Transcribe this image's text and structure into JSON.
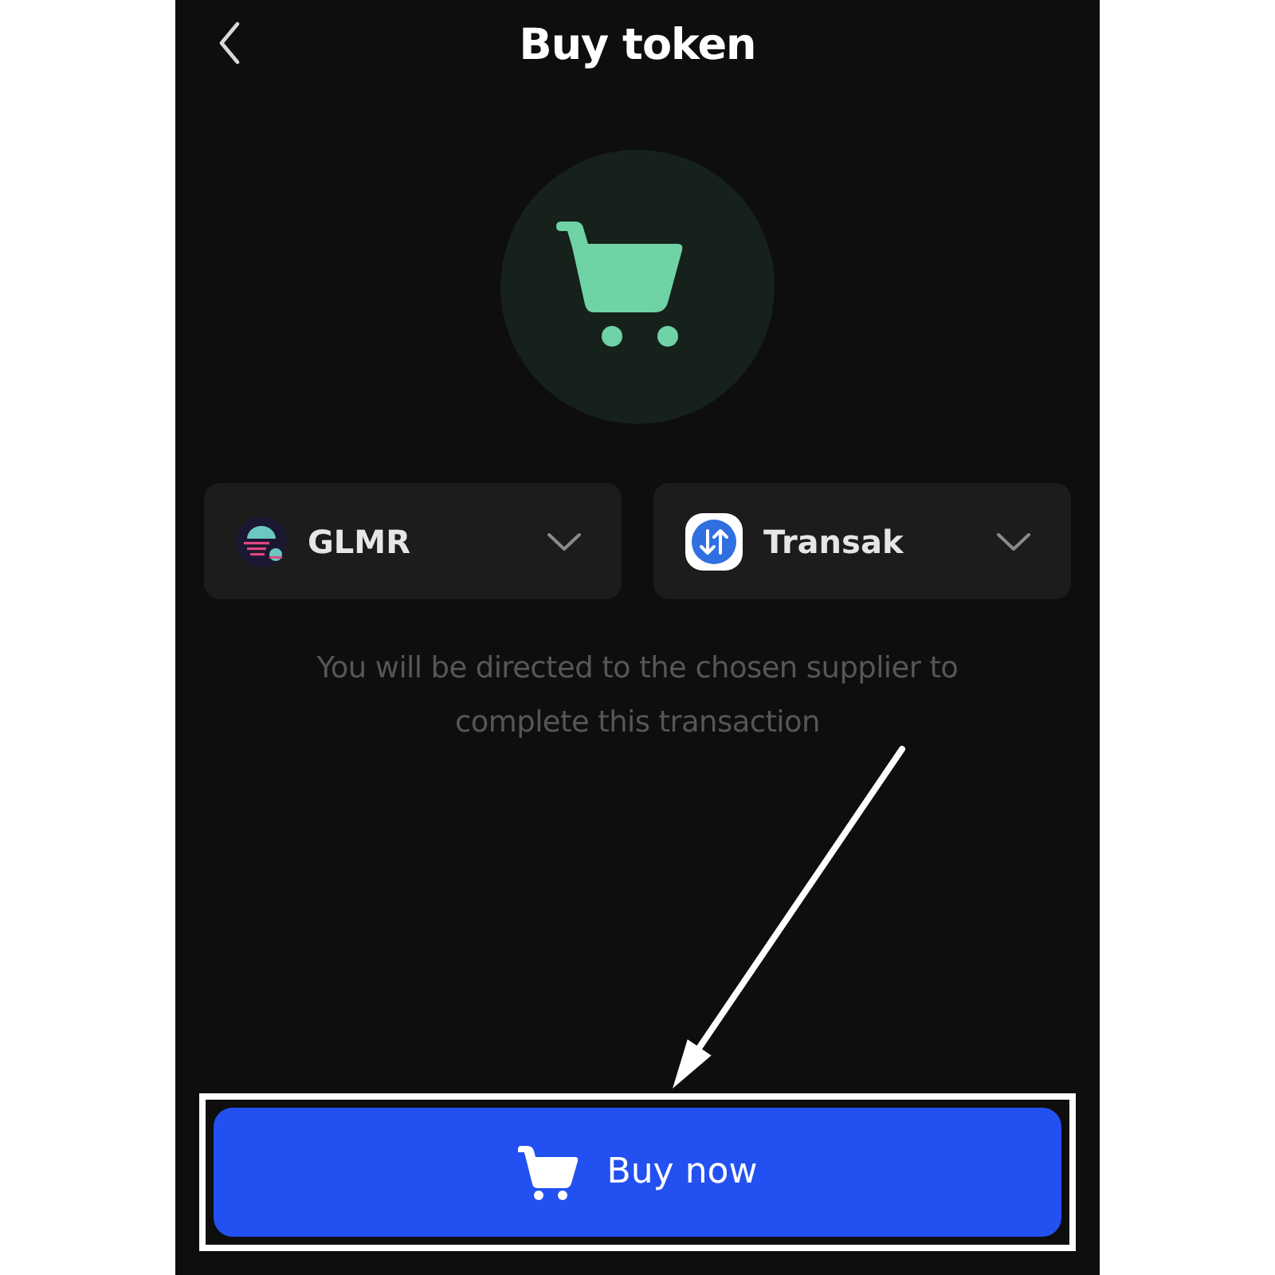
{
  "header": {
    "title": "Buy token"
  },
  "selectors": [
    {
      "kind": "token",
      "label": "GLMR"
    },
    {
      "kind": "provider",
      "label": "Transak"
    }
  ],
  "notice": "You will be directed to the chosen supplier to complete this transaction",
  "buy_button": {
    "label": "Buy now",
    "highlighted": true
  }
}
